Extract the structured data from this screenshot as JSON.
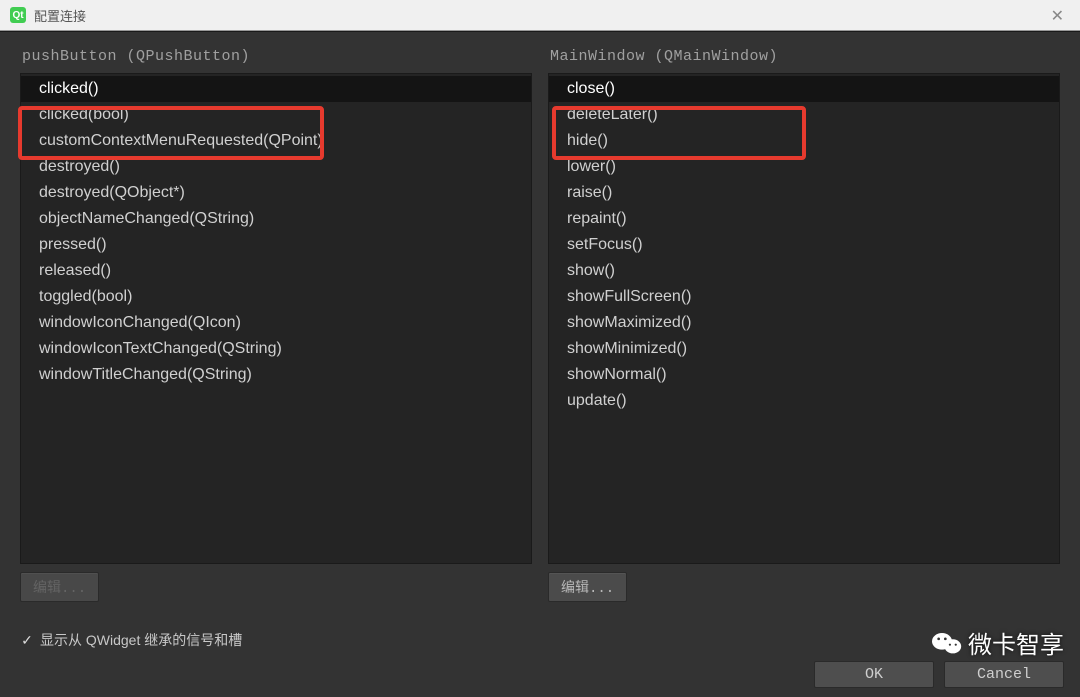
{
  "window": {
    "title": "配置连接",
    "close_label": "✕"
  },
  "left_panel": {
    "header": "pushButton (QPushButton)",
    "items": [
      "clicked()",
      "clicked(bool)",
      "customContextMenuRequested(QPoint)",
      "destroyed()",
      "destroyed(QObject*)",
      "objectNameChanged(QString)",
      "pressed()",
      "released()",
      "toggled(bool)",
      "windowIconChanged(QIcon)",
      "windowIconTextChanged(QString)",
      "windowTitleChanged(QString)"
    ],
    "selected_index": 0,
    "edit_label": "编辑..."
  },
  "right_panel": {
    "header": "MainWindow (QMainWindow)",
    "items": [
      "close()",
      "deleteLater()",
      "hide()",
      "lower()",
      "raise()",
      "repaint()",
      "setFocus()",
      "show()",
      "showFullScreen()",
      "showMaximized()",
      "showMinimized()",
      "showNormal()",
      "update()"
    ],
    "selected_index": 0,
    "edit_label": "编辑..."
  },
  "checkbox": {
    "label": "显示从 QWidget 继承的信号和槽",
    "checked": true
  },
  "buttons": {
    "ok": "OK",
    "cancel": "Cancel"
  },
  "watermark": {
    "text": "微卡智享"
  },
  "icons": {
    "qt": "Qt"
  }
}
